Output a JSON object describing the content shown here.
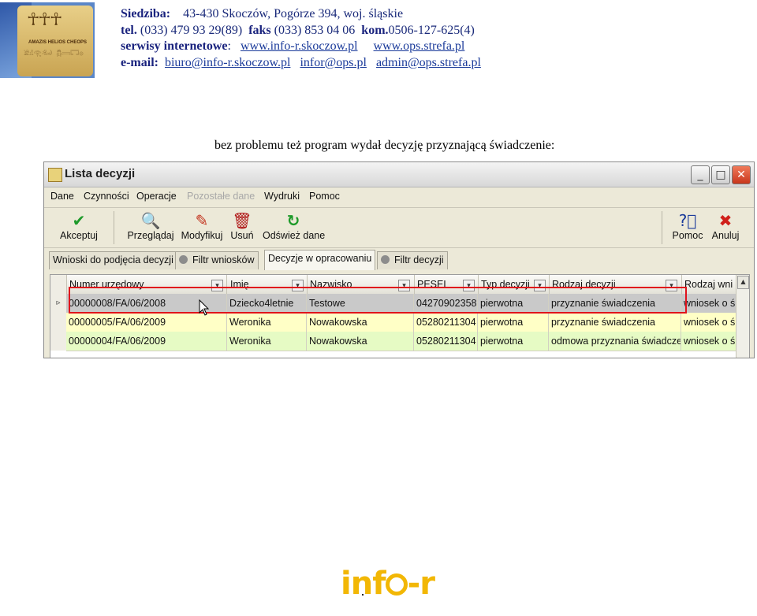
{
  "header": {
    "logo_caption": "AMAZIS HELIOS CHEOPS",
    "line1_label": "Siedziba:",
    "line1_value": "43-430 Skoczów,  Pogórze 394,  woj. śląskie",
    "line2_tel_label": "tel.",
    "line2_tel": "(033) 479 93 29(89)",
    "line2_fax_label": "faks",
    "line2_fax": "(033) 853 04 06",
    "line2_kom_label": "kom.",
    "line2_kom": "0506-127-625(4)",
    "line3_label": "serwisy internetowe",
    "line3_sep": ":",
    "line3_link1": "www.info-r.skoczow.pl",
    "line3_link2": "www.ops.strefa.pl",
    "line4_label": "e-mail:",
    "line4_link1": "biuro@info-r.skoczow.pl",
    "line4_link2": "infor@ops.pl",
    "line4_link3": "admin@ops.strefa.pl"
  },
  "caption": "bez problemu też program wydał decyzję przyznającą świadczenie:",
  "window": {
    "title": "Lista decyzji",
    "menu": [
      "Dane",
      "Czynności",
      "Operacje",
      "Pozostałe dane",
      "Wydruki",
      "Pomoc"
    ],
    "toolbar": {
      "accept": "Akceptuj",
      "browse": "Przeglądaj",
      "modify": "Modyfikuj",
      "delete": "Usuń",
      "refresh": "Odśwież dane",
      "help": "Pomoc",
      "cancel": "Anuluj"
    },
    "tabs": [
      "Wnioski do podjęcia decyzji",
      "Filtr wniosków",
      "Decyzje w opracowaniu",
      "Filtr decyzji"
    ],
    "active_tab": "Decyzje w opracowaniu",
    "columns": [
      "Numer urzędowy",
      "Imię",
      "Nazwisko",
      "PESEL",
      "Typ decyzji",
      "Rodzaj decyzji",
      "Rodzaj wni"
    ],
    "rows": [
      [
        "00000008/FA/06/2008",
        "Dziecko4letnie",
        "Testowe",
        "04270902358",
        "pierwotna",
        "przyznanie świadczenia",
        "wniosek o ś"
      ],
      [
        "00000005/FA/06/2009",
        "Weronika",
        "Nowakowska",
        "05280211304",
        "pierwotna",
        "przyznanie świadczenia",
        "wniosek o ś"
      ],
      [
        "00000004/FA/06/2009",
        "Weronika",
        "Nowakowska",
        "05280211304",
        "pierwotna",
        "odmowa przyznania świadczer",
        "wniosek o ś"
      ]
    ],
    "row_colors": [
      "#c9c9c9",
      "#ffffc6",
      "#e6fbc4"
    ]
  },
  "footer": {
    "logo_part1": "inf",
    "logo_part2": "-r"
  },
  "colors": {
    "highlight": "#e0141c",
    "footer_logo": "#f2b705",
    "header_text": "#1a237e"
  }
}
